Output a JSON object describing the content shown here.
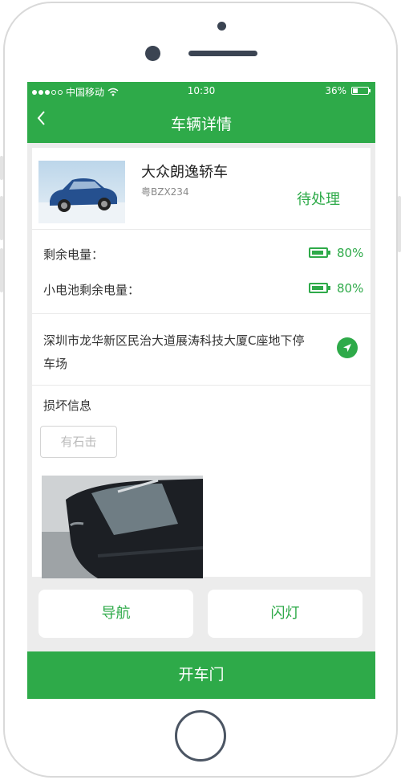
{
  "status_bar": {
    "carrier": "中国移动",
    "time": "10:30",
    "battery": "36%",
    "battery_level": 0.36
  },
  "header": {
    "title": "车辆详情",
    "back_icon": "chevron-left-icon"
  },
  "vehicle": {
    "name": "大众朗逸轿车",
    "plate": "粤BZX234",
    "status": "待处理"
  },
  "power": {
    "main_label": "剩余电量：",
    "main_value": "80%",
    "main_level": 0.8,
    "small_label": "小电池剩余电量：",
    "small_value": "80%",
    "small_level": 0.8
  },
  "location": {
    "address": "深圳市龙华新区民治大道展涛科技大厦C座地下停车场",
    "icon": "navigation-arrow-icon"
  },
  "damage": {
    "title": "损坏信息",
    "tags": [
      "有石击"
    ]
  },
  "actions": {
    "navigate": "导航",
    "flash": "闪灯",
    "open_door": "开车门"
  },
  "colors": {
    "accent": "#2eaa49",
    "background": "#ececec"
  }
}
